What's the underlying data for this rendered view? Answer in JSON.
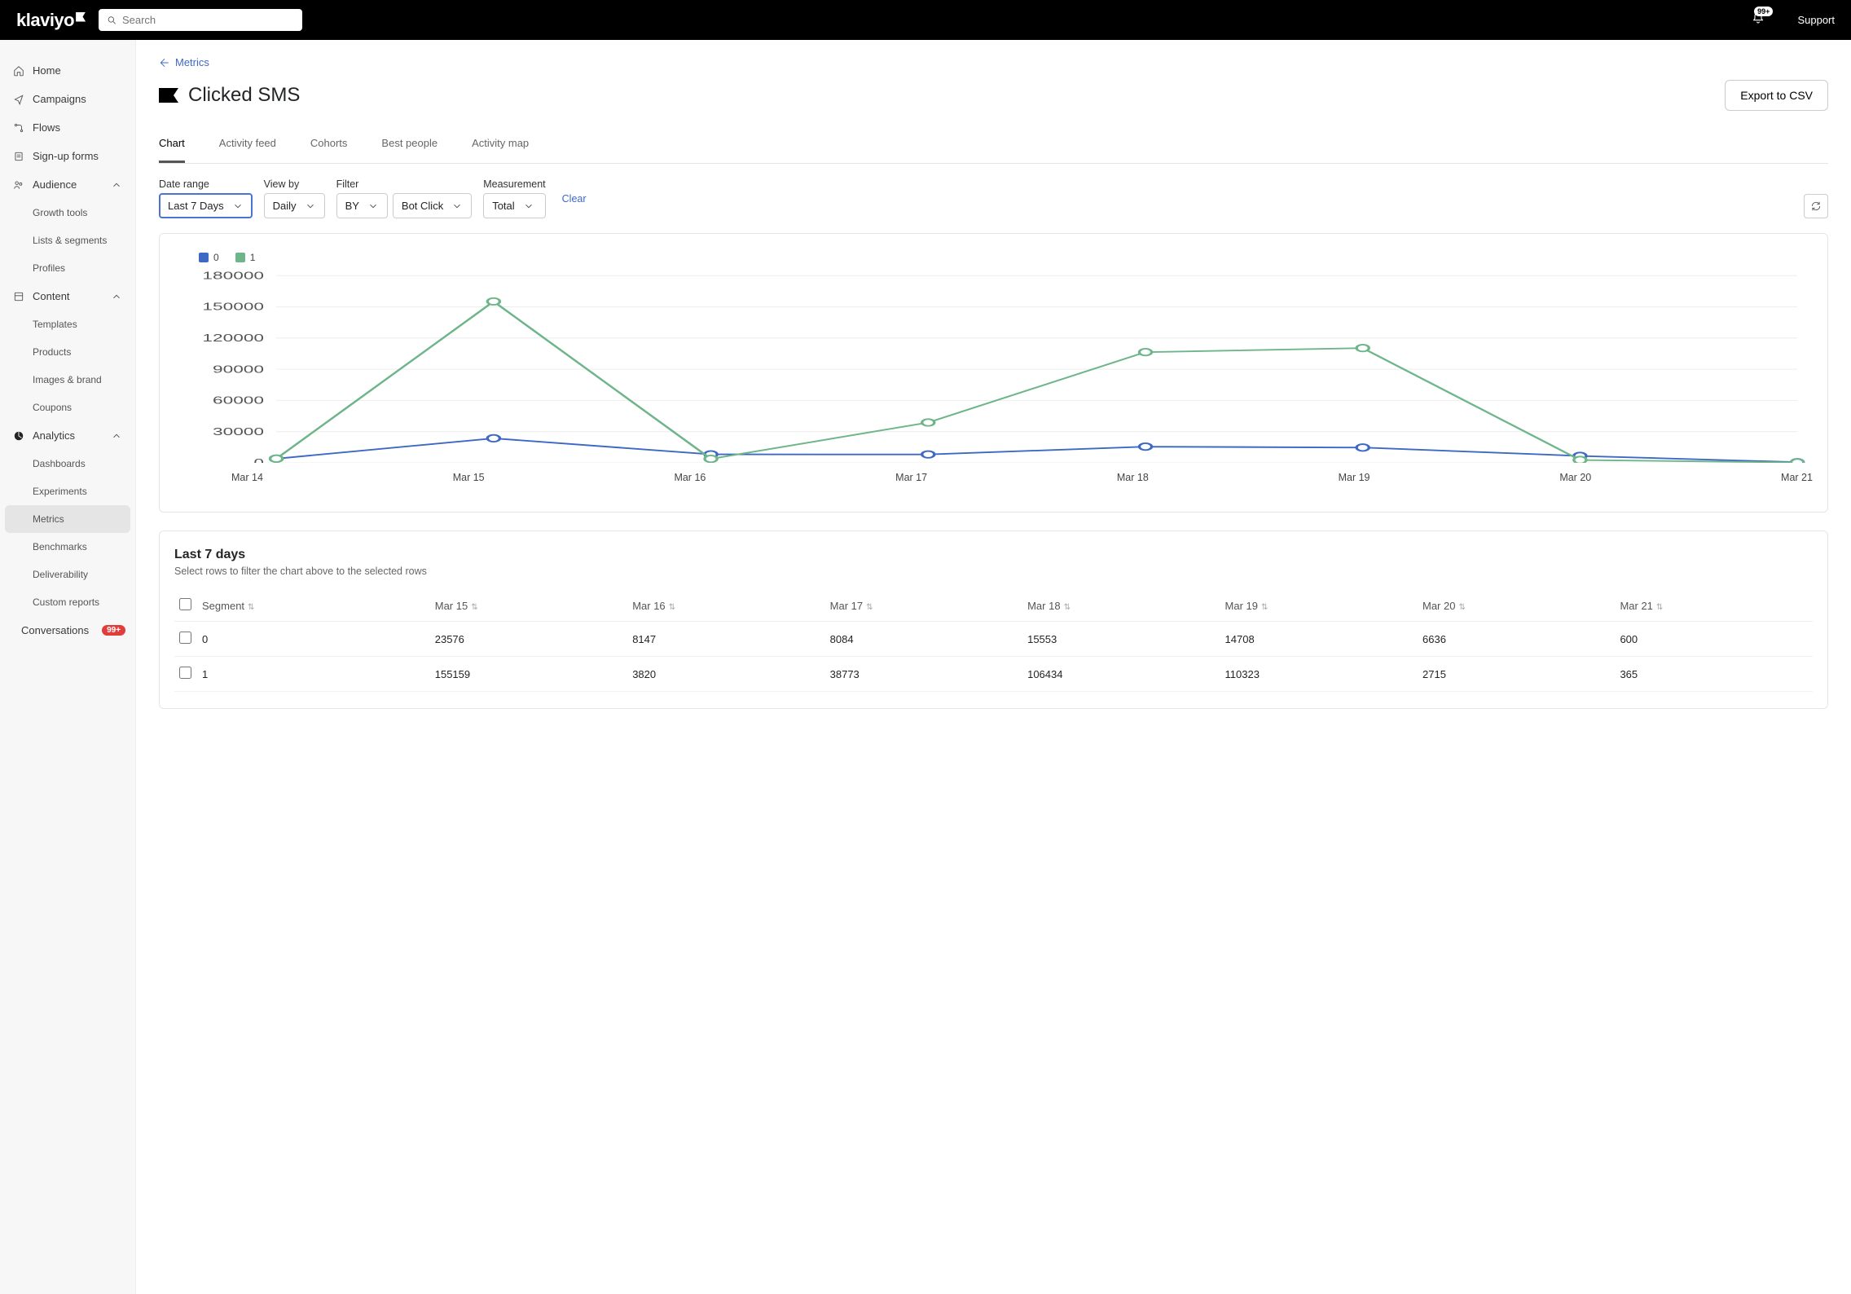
{
  "brand": "klaviyo",
  "search": {
    "placeholder": "Search"
  },
  "notif_badge": "99+",
  "support_label": "Support",
  "sidebar": {
    "items": [
      {
        "label": "Home",
        "type": "top",
        "icon": "home"
      },
      {
        "label": "Campaigns",
        "type": "top",
        "icon": "send"
      },
      {
        "label": "Flows",
        "type": "top",
        "icon": "flow"
      },
      {
        "label": "Sign-up forms",
        "type": "top",
        "icon": "form"
      },
      {
        "label": "Audience",
        "type": "top",
        "icon": "audience",
        "expand": true
      },
      {
        "label": "Growth tools",
        "type": "sub"
      },
      {
        "label": "Lists & segments",
        "type": "sub"
      },
      {
        "label": "Profiles",
        "type": "sub"
      },
      {
        "label": "Content",
        "type": "top",
        "icon": "content",
        "expand": true
      },
      {
        "label": "Templates",
        "type": "sub"
      },
      {
        "label": "Products",
        "type": "sub"
      },
      {
        "label": "Images & brand",
        "type": "sub"
      },
      {
        "label": "Coupons",
        "type": "sub"
      },
      {
        "label": "Analytics",
        "type": "top",
        "icon": "analytics",
        "expand": true,
        "active_section": true
      },
      {
        "label": "Dashboards",
        "type": "sub"
      },
      {
        "label": "Experiments",
        "type": "sub"
      },
      {
        "label": "Metrics",
        "type": "sub",
        "active": true
      },
      {
        "label": "Benchmarks",
        "type": "sub"
      },
      {
        "label": "Deliverability",
        "type": "sub"
      },
      {
        "label": "Custom reports",
        "type": "sub"
      },
      {
        "label": "Conversations",
        "type": "top",
        "icon": "chat",
        "badge": "99+"
      }
    ]
  },
  "back_link": "Metrics",
  "page_title": "Clicked SMS",
  "export_button": "Export to CSV",
  "tabs": [
    "Chart",
    "Activity feed",
    "Cohorts",
    "Best people",
    "Activity map"
  ],
  "active_tab": 0,
  "controls": {
    "date_range": {
      "label": "Date range",
      "value": "Last 7 Days"
    },
    "view_by": {
      "label": "View by",
      "value": "Daily"
    },
    "filter_label": "Filter",
    "filter_by": {
      "value": "BY"
    },
    "filter_val": {
      "value": "Bot Click"
    },
    "measurement": {
      "label": "Measurement",
      "value": "Total"
    },
    "clear": "Clear"
  },
  "legend": [
    {
      "name": "0",
      "color": "#3d68c5"
    },
    {
      "name": "1",
      "color": "#6fb58a"
    }
  ],
  "chart_data": {
    "type": "line",
    "categories": [
      "Mar 14",
      "Mar 15",
      "Mar 16",
      "Mar 17",
      "Mar 18",
      "Mar 19",
      "Mar 20",
      "Mar 21"
    ],
    "ylim": [
      0,
      180000
    ],
    "yticks": [
      0,
      30000,
      60000,
      90000,
      120000,
      150000,
      180000
    ],
    "series": [
      {
        "name": "0",
        "color": "#3d68c5",
        "values": [
          4000,
          23576,
          8147,
          8084,
          15553,
          14708,
          6636,
          600
        ]
      },
      {
        "name": "1",
        "color": "#6fb58a",
        "values": [
          4000,
          155159,
          3820,
          38773,
          106434,
          110323,
          2715,
          365
        ]
      }
    ]
  },
  "table": {
    "title": "Last 7 days",
    "subtitle": "Select rows to filter the chart above to the selected rows",
    "columns": [
      "Segment",
      "Mar 15",
      "Mar 16",
      "Mar 17",
      "Mar 18",
      "Mar 19",
      "Mar 20",
      "Mar 21"
    ],
    "rows": [
      {
        "segment": "0",
        "cells": [
          "23576",
          "8147",
          "8084",
          "15553",
          "14708",
          "6636",
          "600"
        ]
      },
      {
        "segment": "1",
        "cells": [
          "155159",
          "3820",
          "38773",
          "106434",
          "110323",
          "2715",
          "365"
        ]
      }
    ]
  }
}
